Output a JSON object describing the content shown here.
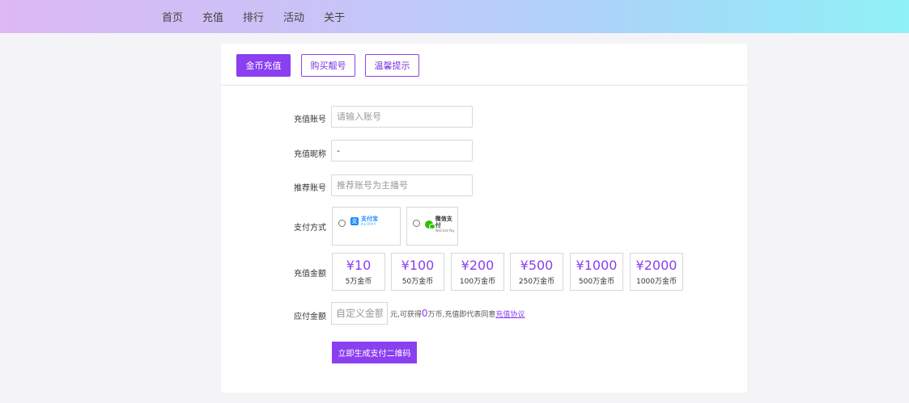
{
  "nav": {
    "items": [
      {
        "label": "首页"
      },
      {
        "label": "充值"
      },
      {
        "label": "排行"
      },
      {
        "label": "活动"
      },
      {
        "label": "关于"
      }
    ]
  },
  "tabs": [
    {
      "label": "金币充值",
      "active": true
    },
    {
      "label": "购买靓号",
      "active": false
    },
    {
      "label": "温馨提示",
      "active": false
    }
  ],
  "form": {
    "account": {
      "label": "充值账号",
      "placeholder": "请输入账号",
      "value": ""
    },
    "nickname": {
      "label": "充值昵称",
      "value": "-"
    },
    "referrer": {
      "label": "推荐账号",
      "placeholder": "推荐账号为主播号",
      "value": ""
    },
    "payment": {
      "label": "支付方式",
      "options": [
        {
          "name": "支付宝",
          "sub": "ALIPAY",
          "icon": "alipay-icon"
        },
        {
          "name": "微信支付",
          "sub": "WeChat Pay",
          "icon": "wechat-pay-icon"
        }
      ]
    },
    "amount": {
      "label": "充值金额",
      "options": [
        {
          "price": "¥10",
          "coins": "5万金币"
        },
        {
          "price": "¥100",
          "coins": "50万金币"
        },
        {
          "price": "¥200",
          "coins": "100万金币"
        },
        {
          "price": "¥500",
          "coins": "250万金币"
        },
        {
          "price": "¥1000",
          "coins": "500万金币"
        },
        {
          "price": "¥2000",
          "coins": "1000万金币"
        }
      ]
    },
    "payable": {
      "label": "应付金额",
      "placeholder": "自定义金额",
      "note_prefix": "元,可获得",
      "coins": "0",
      "note_mid": "万币,充值即代表同意",
      "agreement_link": "充值协议"
    },
    "submit_label": "立即生成支付二维码"
  },
  "colors": {
    "accent": "#8a3ff0",
    "alipay": "#1a8cff",
    "wechat": "#2dc100"
  }
}
